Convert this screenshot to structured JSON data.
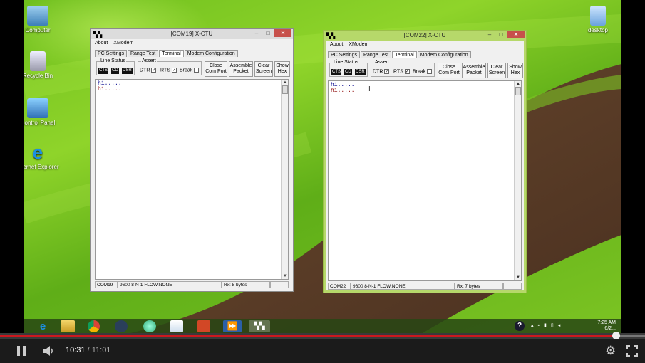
{
  "desktop": {
    "icons": [
      {
        "label": "Computer",
        "name": "computer-icon"
      },
      {
        "label": "Recycle Bin",
        "name": "recycle-bin-icon"
      },
      {
        "label": "Control Panel",
        "name": "control-panel-icon"
      },
      {
        "label": "Internet Explorer",
        "name": "internet-explorer-icon"
      },
      {
        "label": "desktop",
        "name": "folder-icon"
      }
    ]
  },
  "windows": [
    {
      "title": "[COM19] X-CTU",
      "active": false,
      "menu": [
        "About",
        "XModem"
      ],
      "tabs": [
        "PC Settings",
        "Range Test",
        "Terminal",
        "Modem Configuration"
      ],
      "selected_tab": "Terminal",
      "line_status_label": "Line Status",
      "leds": [
        "CTS",
        "CD",
        "DSR"
      ],
      "assert_label": "Assert",
      "checks": [
        "DTR",
        "RTS",
        "Break"
      ],
      "buttons": [
        "Close Com Port",
        "Assemble Packet",
        "Clear Screen",
        "Show Hex"
      ],
      "terminal_lines": [
        "hi.....",
        "hi....."
      ],
      "status": {
        "port": "COM19",
        "settings": "9600 8-N-1  FLOW:NONE",
        "rx": "Rx: 8 bytes"
      }
    },
    {
      "title": "[COM22] X-CTU",
      "active": true,
      "menu": [
        "About",
        "XModem"
      ],
      "tabs": [
        "PC Settings",
        "Range Test",
        "Terminal",
        "Modem Configuration"
      ],
      "selected_tab": "Terminal",
      "line_status_label": "Line Status",
      "leds": [
        "CTS",
        "CD",
        "DSR"
      ],
      "assert_label": "Assert",
      "checks": [
        "DTR",
        "RTS",
        "Break"
      ],
      "buttons": [
        "Close Com Port",
        "Assemble Packet",
        "Clear Screen",
        "Show Hex"
      ],
      "terminal_lines": [
        "hi.....",
        "hi....."
      ],
      "status": {
        "port": "COM22",
        "settings": "9600 8-N-1  FLOW:NONE",
        "rx": "Rx: 7 bytes"
      }
    }
  ],
  "taskbar": {
    "items": [
      "ie-icon",
      "file-explorer-icon",
      "chrome-icon",
      "steam-icon",
      "network-icon",
      "paint-icon",
      "powerpoint-icon",
      "media-player-icon",
      "xctu-icon"
    ],
    "clock_time": "7:25 AM",
    "clock_date": "6/2..."
  },
  "player": {
    "current_time": "10:31",
    "separator": "/",
    "duration": "11:01",
    "progress_fraction": 0.9546,
    "buffered_fraction": 1.0,
    "accent_color": "#cc181e"
  }
}
